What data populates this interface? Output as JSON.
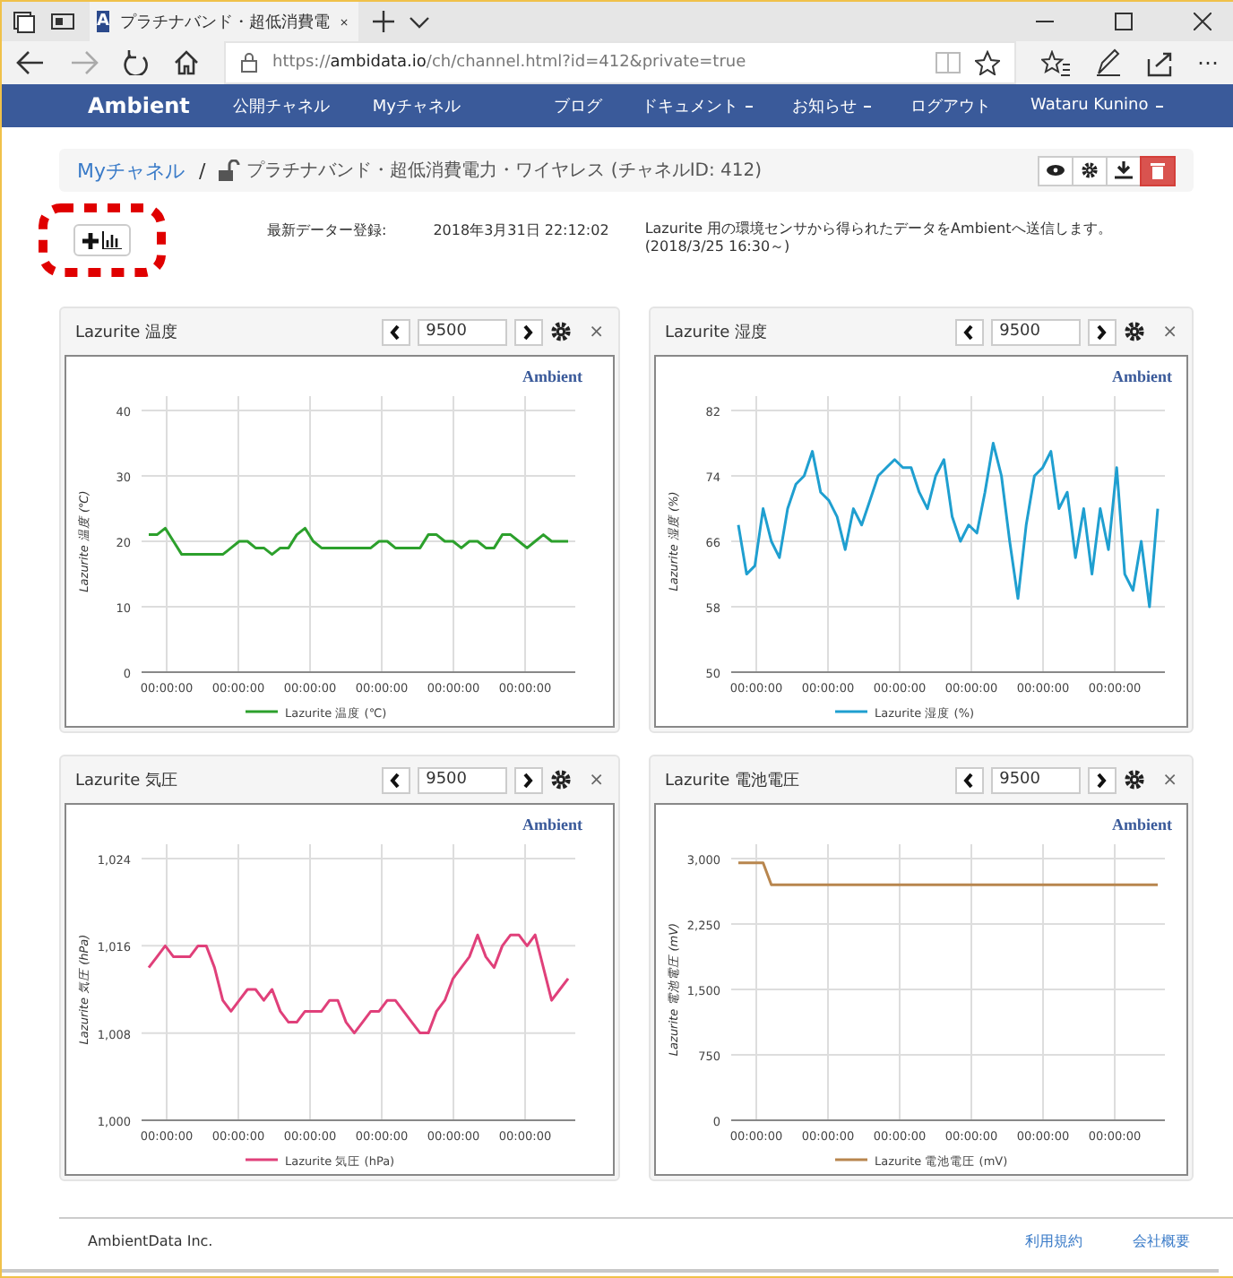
{
  "browser": {
    "tab_title": "プラチナバンド・超低消費電",
    "favicon": "A",
    "url_prefix": "https://",
    "url_host": "ambidata.io",
    "url_path": "/ch/channel.html?id=412&private=true",
    "more": "⋯"
  },
  "navbar": {
    "brand": "Ambient",
    "primary": [
      {
        "label": "公開チャネル",
        "dropdown": false
      },
      {
        "label": "Myチャネル",
        "dropdown": false
      }
    ],
    "secondary": [
      {
        "label": "ブログ",
        "dropdown": false
      },
      {
        "label": "ドキュメント",
        "dropdown": true
      },
      {
        "label": "お知らせ",
        "dropdown": true
      },
      {
        "label": "ログアウト",
        "dropdown": false
      },
      {
        "label": "Wataru Kunino",
        "dropdown": true
      }
    ]
  },
  "channel": {
    "breadcrumb_link": "Myチャネル",
    "separator": "/",
    "title": "プラチナバンド・超低消費電力・ワイヤレス (チャネルID: 412)",
    "actions": [
      {
        "kind": "view"
      },
      {
        "kind": "settings"
      },
      {
        "kind": "download"
      },
      {
        "kind": "delete"
      }
    ]
  },
  "info": {
    "last_update_label": "最新データー登録:",
    "last_update": "2018年3月31日 22:12:02",
    "description": "Lazurite 用の環境センサから得られたデータをAmbientへ送信します。(2018/3/25 16:30～)"
  },
  "panels": [
    {
      "title": "Lazurite 温度",
      "range": "9500",
      "close": "×",
      "brand": "Ambient",
      "x_labels": [
        "00:00:00",
        "00:00:00",
        "00:00:00",
        "00:00:00",
        "00:00:00",
        "00:00:00"
      ],
      "chart_data": {
        "type": "line",
        "grid": true,
        "ylabel": "Lazurite 温度 (℃)",
        "ylim": [
          0,
          40
        ],
        "yticks": [
          0,
          10,
          20,
          30,
          40
        ],
        "series": [
          {
            "name": "Lazurite 温度 (℃)",
            "color": "#2ca02c",
            "values": [
              21,
              21,
              22,
              20,
              18,
              18,
              18,
              18,
              18,
              18,
              19,
              20,
              20,
              19,
              19,
              18,
              19,
              19,
              21,
              22,
              20,
              19,
              19,
              19,
              19,
              19,
              19,
              19,
              20,
              20,
              19,
              19,
              19,
              19,
              21,
              21,
              20,
              20,
              19,
              20,
              20,
              19,
              19,
              21,
              21,
              20,
              19,
              20,
              21,
              20,
              20,
              20
            ]
          }
        ]
      }
    },
    {
      "title": "Lazurite 湿度",
      "range": "9500",
      "close": "×",
      "brand": "Ambient",
      "x_labels": [
        "00:00:00",
        "00:00:00",
        "00:00:00",
        "00:00:00",
        "00:00:00",
        "00:00:00"
      ],
      "chart_data": {
        "type": "line",
        "grid": true,
        "ylabel": "Lazurite 湿度 (%)",
        "ylim": [
          50,
          82
        ],
        "yticks": [
          50,
          58,
          66,
          74,
          82
        ],
        "series": [
          {
            "name": "Lazurite 湿度 (%)",
            "color": "#1f9fd0",
            "values": [
              68,
              62,
              63,
              70,
              66,
              64,
              70,
              73,
              74,
              77,
              72,
              71,
              69,
              65,
              70,
              68,
              71,
              74,
              75,
              76,
              75,
              75,
              72,
              70,
              74,
              76,
              69,
              66,
              68,
              67,
              72,
              78,
              74,
              66,
              59,
              68,
              74,
              75,
              77,
              70,
              72,
              64,
              70,
              62,
              70,
              65,
              75,
              62,
              60,
              66,
              58,
              70
            ]
          }
        ]
      }
    },
    {
      "title": "Lazurite 気圧",
      "range": "9500",
      "close": "×",
      "brand": "Ambient",
      "x_labels": [
        "00:00:00",
        "00:00:00",
        "00:00:00",
        "00:00:00",
        "00:00:00",
        "00:00:00"
      ],
      "chart_data": {
        "type": "line",
        "grid": true,
        "ylabel": "Lazurite 気圧 (hPa)",
        "ylim": [
          1000,
          1024
        ],
        "yticks": [
          {
            "value": 1000,
            "label": "1,000"
          },
          {
            "value": 1008,
            "label": "1,008"
          },
          {
            "value": 1016,
            "label": "1,016"
          },
          {
            "value": 1024,
            "label": "1,024"
          }
        ],
        "series": [
          {
            "name": "Lazurite 気圧 (hPa)",
            "color": "#e0407a",
            "values": [
              1014,
              1015,
              1016,
              1015,
              1015,
              1015,
              1016,
              1016,
              1014,
              1011,
              1010,
              1011,
              1012,
              1012,
              1011,
              1012,
              1010,
              1009,
              1009,
              1010,
              1010,
              1010,
              1011,
              1011,
              1009,
              1008,
              1009,
              1010,
              1010,
              1011,
              1011,
              1010,
              1009,
              1008,
              1008,
              1010,
              1011,
              1013,
              1014,
              1015,
              1017,
              1015,
              1014,
              1016,
              1017,
              1017,
              1016,
              1017,
              1014,
              1011,
              1012,
              1013
            ]
          }
        ]
      }
    },
    {
      "title": "Lazurite 電池電圧",
      "range": "9500",
      "close": "×",
      "brand": "Ambient",
      "x_labels": [
        "00:00:00",
        "00:00:00",
        "00:00:00",
        "00:00:00",
        "00:00:00",
        "00:00:00"
      ],
      "chart_data": {
        "type": "line",
        "grid": true,
        "ylabel": "Lazurite 電池電圧 (mV)",
        "ylim": [
          0,
          3000
        ],
        "yticks": [
          {
            "value": 0,
            "label": "0"
          },
          {
            "value": 750,
            "label": "750"
          },
          {
            "value": 1500,
            "label": "1,500"
          },
          {
            "value": 2250,
            "label": "2,250"
          },
          {
            "value": 3000,
            "label": "3,000"
          }
        ],
        "series": [
          {
            "name": "Lazurite 電池電圧 (mV)",
            "color": "#b8864e",
            "values": [
              2950,
              2950,
              2950,
              2950,
              2700,
              2700,
              2700,
              2700,
              2700,
              2700,
              2700,
              2700,
              2700,
              2700,
              2700,
              2700,
              2700,
              2700,
              2700,
              2700,
              2700,
              2700,
              2700,
              2700,
              2700,
              2700,
              2700,
              2700,
              2700,
              2700,
              2700,
              2700,
              2700,
              2700,
              2700,
              2700,
              2700,
              2700,
              2700,
              2700,
              2700,
              2700,
              2700,
              2700,
              2700,
              2700,
              2700,
              2700,
              2700,
              2700,
              2700,
              2700
            ]
          }
        ]
      }
    }
  ],
  "footer": {
    "company": "AmbientData Inc.",
    "links": [
      "利用規約",
      "会社概要"
    ]
  }
}
